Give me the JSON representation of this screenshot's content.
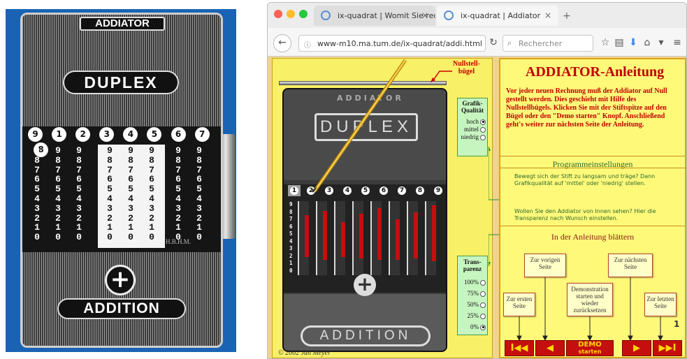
{
  "photo": {
    "brand": "ADDIATOR",
    "model": "DUPLEX",
    "bottom_label": "ADDITION",
    "plus_symbol": "+",
    "digits": [
      "9",
      "1",
      "2",
      "3",
      "4",
      "5",
      "6",
      "7",
      "8"
    ],
    "column_numbers": "9\n8\n7\n6\n5\n4\n3\n2\n1\n0",
    "maker_mark": "H.B.H.M."
  },
  "browser": {
    "tabs": [
      {
        "label": "ix-quadrat | Womit Sie rech..."
      },
      {
        "label": "ix-quadrat | Addiator"
      }
    ],
    "tab_close": "×",
    "new_tab": "+",
    "url": "www-m10.ma.tum.de/ix-quadrat/addi.html",
    "search_placeholder": "Rechercher",
    "icons": {
      "back": "back-arrow-icon",
      "info": "info-icon",
      "reload": "reload-icon",
      "search": "search-icon",
      "bookmark": "star-icon",
      "reader": "reader-icon",
      "download": "download-icon",
      "home": "home-icon",
      "pocket": "pocket-icon",
      "menu": "menu-icon"
    }
  },
  "page": {
    "nullstell_label": "Nullstell-\nbügel",
    "simulator": {
      "brand": "ADDIATOR",
      "model": "DUPLEX",
      "bottom_label": "ADDITION",
      "digits": [
        "1",
        "2",
        "3",
        "4",
        "5",
        "6",
        "7",
        "8",
        "9"
      ],
      "column_numbers": "9\n8\n7\n6\n5\n4\n3\n2\n1\n0"
    },
    "grafik": {
      "title": "Grafik-\nQualität",
      "options": [
        "hoch",
        "mittel",
        "niedrig"
      ],
      "selected": 0
    },
    "transparenz": {
      "title": "Trans-\nparenz",
      "options": [
        "100%",
        "75%",
        "50%",
        "25%",
        "0%"
      ],
      "selected": 4
    },
    "copyright": "© 2002 Jan Meyer",
    "right": {
      "title": "ADDIATOR-Anleitung",
      "intro": "Vor jeder neuen Rechnung muß der Addiator auf Null gestellt werden. Dies geschieht mit Hilfe des Nullstellbügels. Klicken Sie mit der Stiftspitze auf den Bügel oder den \"Demo starten\" Knopf. Anschließend geht's weiter zur nächsten Seite der Anleitung.",
      "settings_title": "Programmeinstellungen",
      "settings_text1": "Bewegt sich der Stift zu langsam und träge? Dann Grafikqualität auf 'mittel' oder 'niedrig' stellen.",
      "settings_text2": "Wollen Sie den Addiator von Innen sehen? Hier die Transparenz nach Wunsch einstellen.",
      "nav_title": "In der Anleitung blättern",
      "box_prev": "Zur vorigen Seite",
      "box_next": "Zur nächsten Seite",
      "box_first": "Zur ersten Seite",
      "box_demo": "Demonstration starten und wieder zurücksetzen",
      "box_last": "Zur letzten Seite",
      "page_number": "1",
      "btn_first": "I◀◀",
      "btn_prev": "◀",
      "btn_demo_top": "DEMO",
      "btn_demo_bottom": "starten",
      "btn_next": "▶",
      "btn_last": "▶▶I"
    }
  },
  "colors": {
    "photo_bg": "#1a63b4",
    "page_bg": "#efd490",
    "title_red": "#c00000",
    "nav_red": "#c50f0f",
    "nav_gold": "#ffd700",
    "green_panel": "#c7f5c0"
  }
}
